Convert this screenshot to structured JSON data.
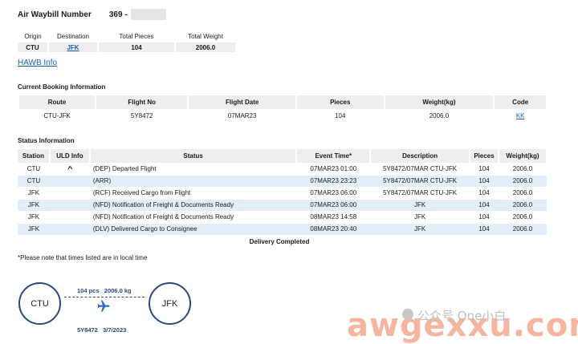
{
  "header": {
    "label": "Air Waybill Number",
    "prefix": "369 -"
  },
  "summary": {
    "headers": [
      "Origin",
      "Destination",
      "Total Pieces",
      "Total Weight"
    ],
    "origin": "CTU",
    "destination": "JFK",
    "total_pieces": "104",
    "total_weight": "2006.0"
  },
  "hawb_link": "HAWB Info",
  "booking": {
    "title": "Current Booking Information",
    "headers": [
      "Route",
      "Flight No",
      "Flight Date",
      "Pieces",
      "Weight(kg)",
      "Code"
    ],
    "row": {
      "route": "CTU-JFK",
      "flight_no": "5Y8472",
      "flight_date": "07MAR23",
      "pieces": "104",
      "weight": "2006.0",
      "code": "KK"
    }
  },
  "status": {
    "title": "Status Information",
    "headers": [
      "Station",
      "ULD Info",
      "Status",
      "Event Time*",
      "Description",
      "Pieces",
      "Weight(kg)"
    ],
    "rows": [
      {
        "station": "CTU",
        "uld": "^",
        "status": "(DEP) Departed Flight",
        "time": "07MAR23 01:00",
        "desc": "5Y8472/07MAR CTU-JFK",
        "pieces": "104",
        "weight": "2006.0"
      },
      {
        "station": "CTU",
        "uld": "",
        "status": "(ARR)",
        "time": "07MAR23 23:23",
        "desc": "5Y8472/07MAR CTU-JFK",
        "pieces": "104",
        "weight": "2006.0"
      },
      {
        "station": "JFK",
        "uld": "",
        "status": "(RCF) Received Cargo from Flight",
        "time": "07MAR23 06:00",
        "desc": "5Y8472/07MAR CTU-JFK",
        "pieces": "104",
        "weight": "2006.0"
      },
      {
        "station": "JFK",
        "uld": "",
        "status": "(NFD) Notification of Freight & Documents Ready",
        "time": "07MAR23 06:00",
        "desc": "JFK",
        "pieces": "104",
        "weight": "2006.0"
      },
      {
        "station": "JFK",
        "uld": "",
        "status": "(NFD) Notification of Freight & Documents Ready",
        "time": "08MAR23 14:58",
        "desc": "JFK",
        "pieces": "104",
        "weight": "2006.0"
      },
      {
        "station": "JFK",
        "uld": "",
        "status": "(DLV) Delivered Cargo to Consignee",
        "time": "08MAR23 20:40",
        "desc": "JFK",
        "pieces": "104",
        "weight": "2006.0"
      }
    ],
    "delivery": "Delivery Completed",
    "note": "*Please note that times listed are in local time"
  },
  "journey": {
    "origin": "CTU",
    "destination": "JFK",
    "pieces": "104 pcs",
    "weight": "2006.0 kg",
    "flight": "5Y8472",
    "date": "3/7/2023",
    "line_color": "#2b4a7a"
  },
  "watermark": {
    "text": "awgexxu.com",
    "chinese": "公众号 One小白"
  },
  "colors": {
    "link": "#1a5fb4",
    "header_bg": "#eeeeee",
    "alt_row": "#e3eefb"
  }
}
